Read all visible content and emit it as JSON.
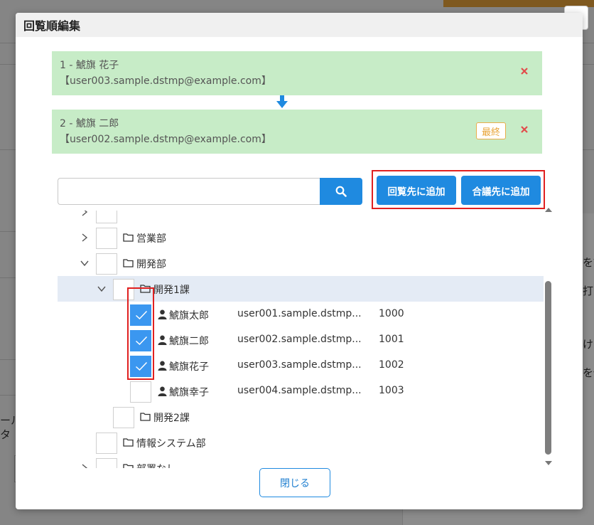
{
  "background": {
    "fragments": [
      "ール",
      "タ",
      "を読",
      "打す",
      "ける",
      "を保"
    ]
  },
  "modal": {
    "title": "回覧順編集",
    "approvers": [
      {
        "label": "1 - 鯱旗 花子",
        "email": "【user003.sample.dstmp@example.com】",
        "final": false
      },
      {
        "label": "2 - 鯱旗 二郎",
        "email": "【user002.sample.dstmp@example.com】",
        "final": true,
        "final_label": "最終"
      }
    ],
    "search": {
      "value": "",
      "placeholder": ""
    },
    "buttons": {
      "add_circulation": "回覧先に追加",
      "add_consultation": "合議先に追加",
      "close": "閉じる"
    }
  },
  "tree": {
    "folders": {
      "sales": "営業部",
      "dev": "開発部",
      "dev1": "開発1課",
      "dev2": "開発2課",
      "infosys": "情報システム部",
      "nodept": "部署なし"
    },
    "users": [
      {
        "name": "鯱旗太郎",
        "email": "user001.sample.dstmp...",
        "code": "1000",
        "checked": true
      },
      {
        "name": "鯱旗二郎",
        "email": "user002.sample.dstmp...",
        "code": "1001",
        "checked": true
      },
      {
        "name": "鯱旗花子",
        "email": "user003.sample.dstmp...",
        "code": "1002",
        "checked": true
      },
      {
        "name": "鯱旗幸子",
        "email": "user004.sample.dstmp...",
        "code": "1003",
        "checked": false
      }
    ]
  },
  "colors": {
    "primary": "#1f8ae0",
    "approver_bg": "#c7ecc7",
    "remove": "#e24b4b",
    "final_badge": "#e9ad4a",
    "highlight": "#e02020",
    "checked": "#3b97f0",
    "selected_row": "#e4ebf5"
  }
}
